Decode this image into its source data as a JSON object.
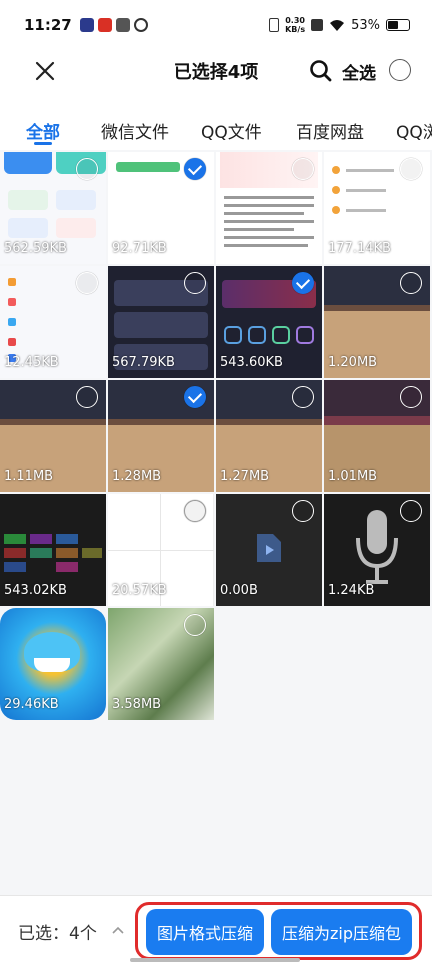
{
  "status_bar": {
    "time": "11:27",
    "net_speed_value": "0.30",
    "net_speed_unit": "KB/s",
    "battery": "53%"
  },
  "header": {
    "title": "已选择4项",
    "select_all": "全选",
    "close_icon": "close-icon",
    "search_icon": "search-icon"
  },
  "tabs": [
    {
      "label": "全部",
      "active": true
    },
    {
      "label": "微信文件",
      "active": false
    },
    {
      "label": "QQ文件",
      "active": false
    },
    {
      "label": "百度网盘",
      "active": false
    },
    {
      "label": "QQ浏",
      "active": false
    }
  ],
  "grid": {
    "items": [
      {
        "size": "562.59KB",
        "selected": false
      },
      {
        "size": "92.71KB",
        "selected": true
      },
      {
        "size": "",
        "selected": false
      },
      {
        "size": "177.14KB",
        "selected": false
      },
      {
        "size": "12.45KB",
        "selected": false
      },
      {
        "size": "567.79KB",
        "selected": false
      },
      {
        "size": "543.60KB",
        "selected": true
      },
      {
        "size": "1.20MB",
        "selected": false
      },
      {
        "size": "1.11MB",
        "selected": false
      },
      {
        "size": "1.28MB",
        "selected": true
      },
      {
        "size": "1.27MB",
        "selected": false
      },
      {
        "size": "1.01MB",
        "selected": false
      },
      {
        "size": "543.02KB",
        "selected": false
      },
      {
        "size": "20.57KB",
        "selected": false
      },
      {
        "size": "0.00B",
        "selected": false
      },
      {
        "size": "1.24KB",
        "selected": false
      },
      {
        "size": "29.46KB",
        "selected": false
      },
      {
        "size": "3.58MB",
        "selected": false
      }
    ]
  },
  "bottom_bar": {
    "selected_label": "已选：4个",
    "btn_image_compress": "图片格式压缩",
    "btn_zip": "压缩为zip压缩包"
  },
  "colors": {
    "accent": "#1a73e8",
    "button": "#1a7cf0",
    "highlight_outline": "#e02b2b"
  }
}
